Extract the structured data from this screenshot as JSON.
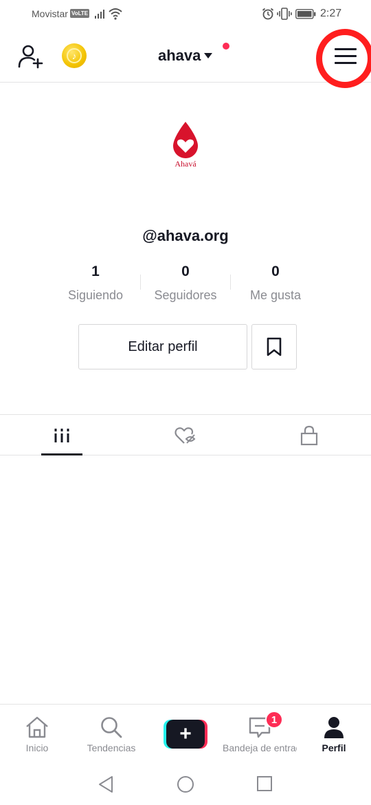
{
  "status_bar": {
    "carrier": "Movistar",
    "volte": "VoLTE",
    "time": "2:27",
    "icons": [
      "signal-icon",
      "wifi-icon",
      "alarm-icon",
      "vibrate-icon",
      "battery-icon"
    ]
  },
  "header": {
    "account_name": "ahava",
    "icons": [
      "add-user-icon",
      "coin-icon",
      "menu-icon"
    ],
    "highlight_color": "#ff1e1e",
    "notification_dot_color": "#fe2c55"
  },
  "profile": {
    "logo_text": "Ahavá",
    "logo_color": "#c8102e",
    "username": "@ahava.org",
    "stats": [
      {
        "value": "1",
        "label": "Siguiendo"
      },
      {
        "value": "0",
        "label": "Seguidores"
      },
      {
        "value": "0",
        "label": "Me gusta"
      }
    ],
    "edit_button_label": "Editar perfil"
  },
  "tabs": [
    {
      "icon": "videos-grid-icon",
      "active": true
    },
    {
      "icon": "liked-hidden-icon",
      "active": false
    },
    {
      "icon": "lock-icon",
      "active": false
    }
  ],
  "bottom_nav": {
    "items": [
      {
        "label": "Inicio",
        "icon": "home-icon"
      },
      {
        "label": "Tendencias",
        "icon": "search-icon"
      },
      {
        "label": "",
        "icon": "create-plus-icon"
      },
      {
        "label": "Bandeja de entrada",
        "icon": "inbox-icon",
        "badge": "1"
      },
      {
        "label": "Perfil",
        "icon": "profile-icon",
        "active": true
      }
    ]
  },
  "system_nav": [
    "back-icon",
    "home-circle-icon",
    "recents-icon"
  ],
  "colors": {
    "text_primary": "#161823",
    "text_secondary": "#8a8b91",
    "accent_red": "#fe2c55",
    "accent_cyan": "#25f4ee"
  }
}
